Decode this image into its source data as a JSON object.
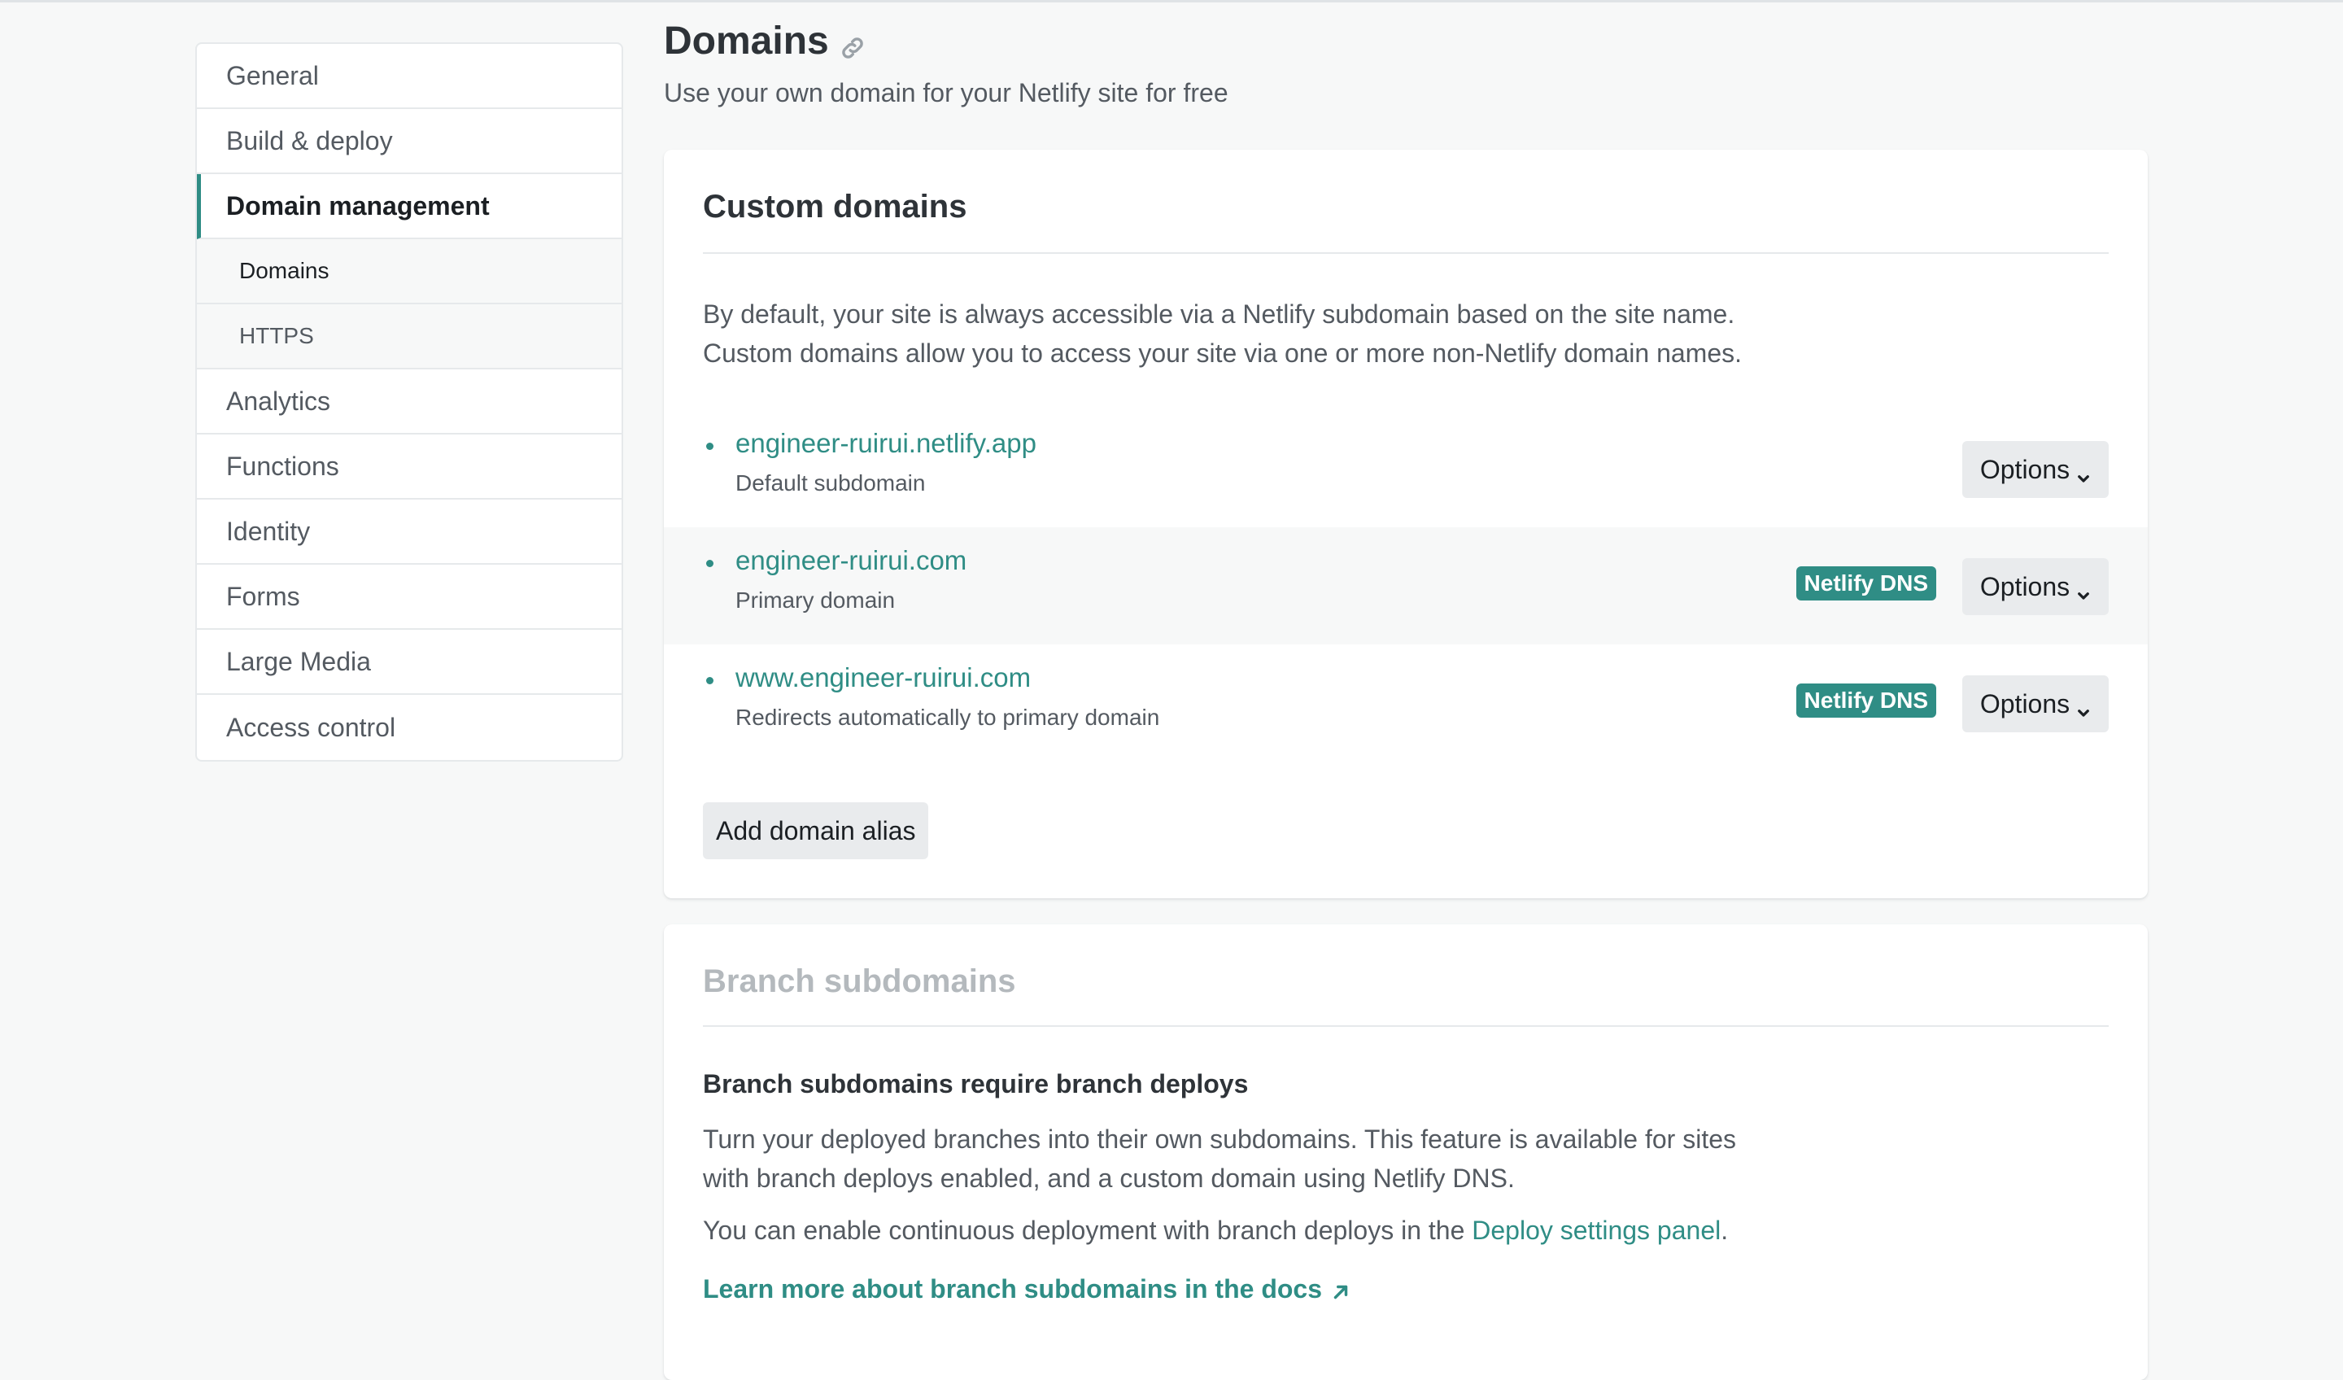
{
  "sidebar": {
    "items": [
      {
        "label": "General"
      },
      {
        "label": "Build & deploy"
      },
      {
        "label": "Domain management"
      },
      {
        "label": "Domains"
      },
      {
        "label": "HTTPS"
      },
      {
        "label": "Analytics"
      },
      {
        "label": "Functions"
      },
      {
        "label": "Identity"
      },
      {
        "label": "Forms"
      },
      {
        "label": "Large Media"
      },
      {
        "label": "Access control"
      }
    ]
  },
  "header": {
    "title": "Domains",
    "subtitle": "Use your own domain for your Netlify site for free",
    "link_icon": "link-icon"
  },
  "custom_domains": {
    "title": "Custom domains",
    "description_line1": "By default, your site is always accessible via a Netlify subdomain based on the site name.",
    "description_line2": "Custom domains allow you to access your site via one or more non-Netlify domain names.",
    "domains": [
      {
        "name": "engineer-ruirui.netlify.app",
        "note": "Default subdomain",
        "badge": "",
        "options": "Options"
      },
      {
        "name": "engineer-ruirui.com",
        "note": "Primary domain",
        "badge": "Netlify DNS",
        "options": "Options"
      },
      {
        "name": "www.engineer-ruirui.com",
        "note": "Redirects automatically to primary domain",
        "badge": "Netlify DNS",
        "options": "Options"
      }
    ],
    "add_alias_label": "Add domain alias"
  },
  "branch_subdomains": {
    "title": "Branch subdomains",
    "subheading": "Branch subdomains require branch deploys",
    "para1_line1": "Turn your deployed branches into their own subdomains. This feature is available for sites",
    "para1_line2": "with branch deploys enabled, and a custom domain using Netlify DNS.",
    "para2_prefix": "You can enable continuous deployment with branch deploys in the ",
    "para2_link": "Deploy settings panel",
    "para2_suffix": ".",
    "docs_link": "Learn more about branch subdomains in the docs"
  },
  "colors": {
    "accent": "#2f8d85",
    "background": "#f7f8f8",
    "muted_title": "#b4b9bd"
  }
}
